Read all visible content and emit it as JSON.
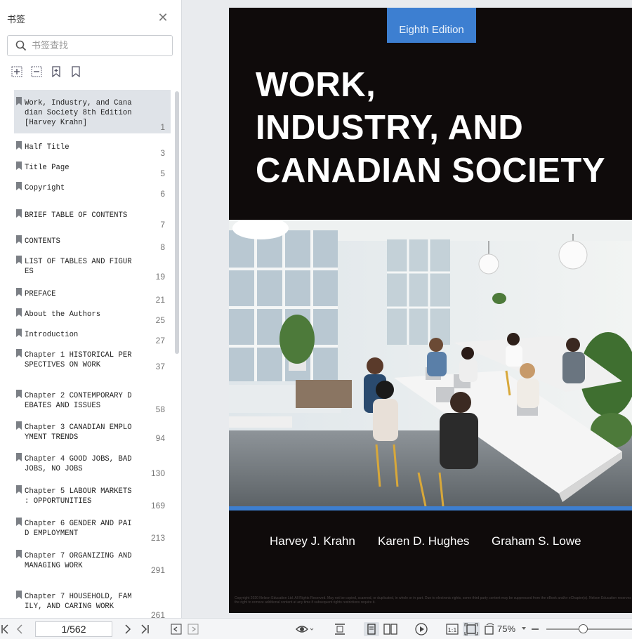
{
  "sidebar": {
    "title": "书签",
    "search_placeholder": "书签查找",
    "bookmarks": [
      {
        "label": "Work, Industry, and Cana\ndian Society 8th Edition\n[Harvey Krahn]",
        "page": "1"
      },
      {
        "label": "Half Title",
        "page": "3"
      },
      {
        "label": "Title Page",
        "page": "5"
      },
      {
        "label": "Copyright",
        "page": "6"
      },
      {
        "label": "BRIEF TABLE OF CONTENTS",
        "page": "7"
      },
      {
        "label": "CONTENTS",
        "page": "8"
      },
      {
        "label": "LIST OF TABLES AND FIGUR\nES",
        "page": "19"
      },
      {
        "label": "PREFACE",
        "page": "21"
      },
      {
        "label": "About the Authors",
        "page": "25"
      },
      {
        "label": "Introduction",
        "page": "27"
      },
      {
        "label": "Chapter 1 HISTORICAL PER\nSPECTIVES ON WORK",
        "page": "37"
      },
      {
        "label": "Chapter 2 CONTEMPORARY D\nEBATES AND ISSUES",
        "page": "58"
      },
      {
        "label": "Chapter 3 CANADIAN EMPLO\nYMENT TRENDS",
        "page": "94"
      },
      {
        "label": "Chapter 4 GOOD JOBS, BAD\nJOBS, NO JOBS",
        "page": "130"
      },
      {
        "label": "Chapter 5 LABOUR MARKETS\n: OPPORTUNITIES",
        "page": "169"
      },
      {
        "label": "Chapter 6 GENDER AND PAI\nD EMPLOYMENT",
        "page": "213"
      },
      {
        "label": "Chapter 7 ORGANIZING AND\nMANAGING WORK",
        "page": "291"
      },
      {
        "label": "Chapter 7 HOUSEHOLD, FAM\nILY, AND CARING WORK",
        "page": "261"
      }
    ]
  },
  "cover": {
    "edition": "Eighth Edition",
    "title_lines": [
      "WORK,",
      "INDUSTRY, AND",
      "CANADIAN SOCIETY"
    ],
    "authors": [
      "Harvey J. Krahn",
      "Karen D. Hughes",
      "Graham S. Lowe"
    ],
    "fine_print": "Copyright 2020 Nelson Education Ltd. All Rights Reserved. May not be copied, scanned, or duplicated, in whole or in part. Due to electronic rights, some third party content may be suppressed from the eBook and/or eChapter(s). Nelson Education reserves the right to remove additional content at any time if subsequent rights restrictions require it."
  },
  "toolbar": {
    "page_value": "1/562",
    "zoom": "75%"
  },
  "colors": {
    "accent_blue": "#3d7fd1",
    "cover_bg": "#0f0b0b",
    "selected_bg": "#dfe3e8"
  }
}
